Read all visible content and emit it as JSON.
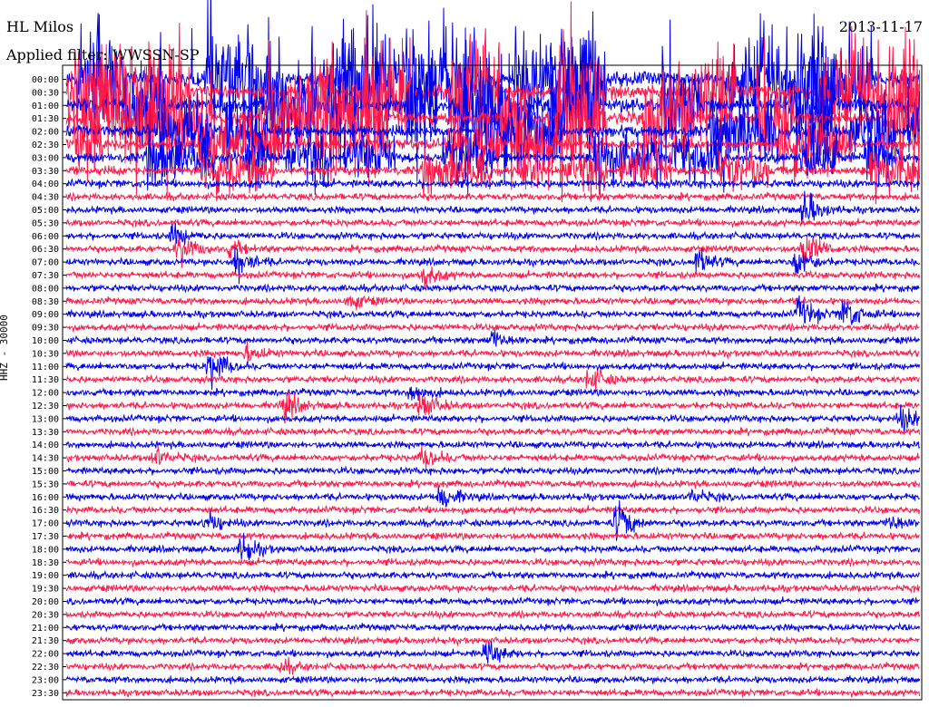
{
  "header": {
    "station": "HL Milos",
    "filter": "Applied filter: WWSSN-SP",
    "date": "2013-11-17"
  },
  "colors": {
    "trace_a": "#0000ee",
    "trace_b": "#ff1a4b",
    "frame": "#000000",
    "background": "#ffffff"
  },
  "chart_data": {
    "type": "line",
    "title": "HL Milos",
    "xlabel": "",
    "ylabel": "HHZ - 30000",
    "row_interval_minutes": 30,
    "rows_per_day": 48,
    "color_pattern": [
      "trace_a",
      "trace_b"
    ],
    "tick_labels": [
      "00:00",
      "00:30",
      "01:00",
      "01:30",
      "02:00",
      "02:30",
      "03:00",
      "03:30",
      "04:00",
      "04:30",
      "05:00",
      "05:30",
      "06:00",
      "06:30",
      "07:00",
      "07:30",
      "08:00",
      "08:30",
      "09:00",
      "09:30",
      "10:00",
      "10:30",
      "11:00",
      "11:30",
      "12:00",
      "12:30",
      "13:00",
      "13:30",
      "14:00",
      "14:30",
      "15:00",
      "15:30",
      "16:00",
      "16:30",
      "17:00",
      "17:30",
      "18:00",
      "18:30",
      "19:00",
      "19:30",
      "20:00",
      "20:30",
      "21:00",
      "21:30",
      "22:00",
      "22:30",
      "23:00",
      "23:30"
    ],
    "noise_level": [
      2.6,
      2.6,
      2.5,
      2.4,
      1.9,
      1.6,
      1.4,
      1.2,
      0.8,
      0.6,
      0.55,
      0.55,
      0.55,
      0.55,
      0.55,
      0.55,
      0.55,
      0.55,
      0.55,
      0.55,
      0.55,
      0.55,
      0.55,
      0.55,
      0.55,
      0.55,
      0.55,
      0.55,
      0.55,
      0.55,
      0.55,
      0.55,
      0.55,
      0.55,
      0.55,
      0.55,
      0.55,
      0.55,
      0.55,
      0.55,
      0.5,
      0.5,
      0.5,
      0.5,
      0.5,
      0.5,
      0.5,
      0.5
    ],
    "events": [
      {
        "row": 10,
        "minute": 26.0,
        "amp": 2.2
      },
      {
        "row": 12,
        "minute": 3.8,
        "amp": 1.4
      },
      {
        "row": 13,
        "minute": 4.0,
        "amp": 2.0
      },
      {
        "row": 13,
        "minute": 5.8,
        "amp": 1.0
      },
      {
        "row": 13,
        "minute": 26.0,
        "amp": 2.2
      },
      {
        "row": 14,
        "minute": 6.0,
        "amp": 2.0
      },
      {
        "row": 14,
        "minute": 22.2,
        "amp": 1.6
      },
      {
        "row": 14,
        "minute": 25.7,
        "amp": 1.8
      },
      {
        "row": 15,
        "minute": 12.6,
        "amp": 1.4
      },
      {
        "row": 17,
        "minute": 10.0,
        "amp": 1.0
      },
      {
        "row": 18,
        "minute": 27.4,
        "amp": 2.2
      },
      {
        "row": 18,
        "minute": 25.8,
        "amp": 2.0
      },
      {
        "row": 20,
        "minute": 15.0,
        "amp": 1.2
      },
      {
        "row": 21,
        "minute": 6.4,
        "amp": 1.0
      },
      {
        "row": 22,
        "minute": 5.1,
        "amp": 2.4
      },
      {
        "row": 23,
        "minute": 18.4,
        "amp": 1.6
      },
      {
        "row": 24,
        "minute": 12.2,
        "amp": 1.2
      },
      {
        "row": 25,
        "minute": 7.7,
        "amp": 1.6
      },
      {
        "row": 25,
        "minute": 12.5,
        "amp": 1.8
      },
      {
        "row": 26,
        "minute": 29.4,
        "amp": 1.4
      },
      {
        "row": 29,
        "minute": 3.2,
        "amp": 1.4
      },
      {
        "row": 29,
        "minute": 12.6,
        "amp": 1.4
      },
      {
        "row": 32,
        "minute": 13.2,
        "amp": 1.8
      },
      {
        "row": 32,
        "minute": 22.0,
        "amp": 1.0
      },
      {
        "row": 34,
        "minute": 5.0,
        "amp": 1.2
      },
      {
        "row": 34,
        "minute": 19.4,
        "amp": 2.4
      },
      {
        "row": 34,
        "minute": 29.0,
        "amp": 1.0
      },
      {
        "row": 36,
        "minute": 6.2,
        "amp": 1.6
      },
      {
        "row": 44,
        "minute": 14.8,
        "amp": 1.6
      },
      {
        "row": 45,
        "minute": 7.6,
        "amp": 0.8
      }
    ]
  }
}
